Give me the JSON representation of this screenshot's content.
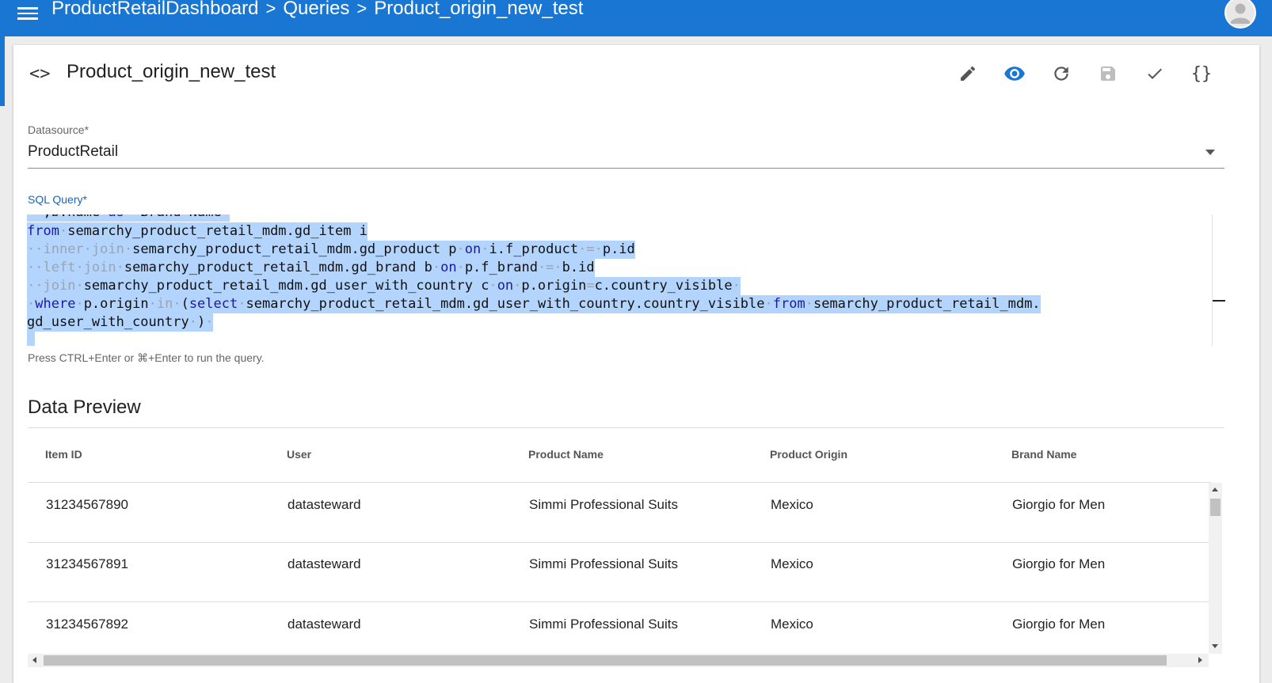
{
  "header": {
    "breadcrumb": [
      "ProductRetailDashboard",
      "Queries",
      "Product_origin_new_test"
    ]
  },
  "query": {
    "title": "Product_origin_new_test"
  },
  "toolbar": {
    "icons": [
      "pencil-icon",
      "eye-icon",
      "refresh-icon",
      "save-icon",
      "check-icon",
      "braces-icon"
    ],
    "active_color": "#1976d2",
    "braces_label": "{}"
  },
  "code_toggle_glyph": "<>",
  "datasource": {
    "label": "Datasource*",
    "value": "ProductRetail"
  },
  "sql": {
    "label": "SQL Query*",
    "lines": [
      [
        {
          "t": "  ,b.name ",
          "c": ""
        },
        {
          "t": "as",
          "c": "kw"
        },
        {
          "t": " \"Brand Name\"",
          "c": ""
        }
      ],
      [
        {
          "t": "from",
          "c": "kw"
        },
        {
          "t": "·",
          "c": "ws"
        },
        {
          "t": "semarchy_product_retail_mdm.gd_item i",
          "c": ""
        }
      ],
      [
        {
          "t": "··",
          "c": "ws"
        },
        {
          "t": "inner",
          "c": "ws"
        },
        {
          "t": "·",
          "c": "ws"
        },
        {
          "t": "join",
          "c": "ws"
        },
        {
          "t": "·",
          "c": "ws"
        },
        {
          "t": "semarchy_product_retail_mdm.gd_product p",
          "c": ""
        },
        {
          "t": "·",
          "c": "ws"
        },
        {
          "t": "on",
          "c": "kw"
        },
        {
          "t": "·",
          "c": "ws"
        },
        {
          "t": "i.f_product",
          "c": ""
        },
        {
          "t": "·=·",
          "c": "ws"
        },
        {
          "t": "p.id",
          "c": ""
        }
      ],
      [
        {
          "t": "··",
          "c": "ws"
        },
        {
          "t": "left",
          "c": "ws"
        },
        {
          "t": "·",
          "c": "ws"
        },
        {
          "t": "join",
          "c": "ws"
        },
        {
          "t": "·",
          "c": "ws"
        },
        {
          "t": "semarchy_product_retail_mdm.gd_brand b",
          "c": ""
        },
        {
          "t": "·",
          "c": "ws"
        },
        {
          "t": "on",
          "c": "kw"
        },
        {
          "t": "·",
          "c": "ws"
        },
        {
          "t": "p.f_brand",
          "c": ""
        },
        {
          "t": "·=·",
          "c": "ws"
        },
        {
          "t": "b.id",
          "c": ""
        }
      ],
      [
        {
          "t": "··",
          "c": "ws"
        },
        {
          "t": "join",
          "c": "ws"
        },
        {
          "t": "·",
          "c": "ws"
        },
        {
          "t": "semarchy_product_retail_mdm.gd_user_with_country c",
          "c": ""
        },
        {
          "t": "·",
          "c": "ws"
        },
        {
          "t": "on",
          "c": "kw"
        },
        {
          "t": "·",
          "c": "ws"
        },
        {
          "t": "p.origin",
          "c": ""
        },
        {
          "t": "=",
          "c": "ws"
        },
        {
          "t": "c.country_visible",
          "c": ""
        },
        {
          "t": "·",
          "c": "ws"
        }
      ],
      [
        {
          "t": "·",
          "c": "ws"
        },
        {
          "t": "where",
          "c": "kw"
        },
        {
          "t": "·",
          "c": "ws"
        },
        {
          "t": "p.origin",
          "c": ""
        },
        {
          "t": "·",
          "c": "ws"
        },
        {
          "t": "in",
          "c": "ws"
        },
        {
          "t": "·",
          "c": "ws"
        },
        {
          "t": "(",
          "c": ""
        },
        {
          "t": "select",
          "c": "kw"
        },
        {
          "t": "·",
          "c": "ws"
        },
        {
          "t": "semarchy_product_retail_mdm.gd_user_with_country.country_visible",
          "c": ""
        },
        {
          "t": "·",
          "c": "ws"
        },
        {
          "t": "from",
          "c": "kw"
        },
        {
          "t": "·",
          "c": "ws"
        },
        {
          "t": "semarchy_product_retail_mdm.",
          "c": ""
        }
      ],
      [
        {
          "t": "gd_user_with_country",
          "c": ""
        },
        {
          "t": "·",
          "c": "ws"
        },
        {
          "t": ")",
          "c": ""
        },
        {
          "t": "·",
          "c": "ws"
        }
      ],
      [
        {
          "t": " ",
          "c": ""
        }
      ]
    ]
  },
  "hint": "Press CTRL+Enter or ⌘+Enter to run the query.",
  "preview": {
    "title": "Data Preview",
    "columns": [
      "Item ID",
      "User",
      "Product Name",
      "Product Origin",
      "Brand Name"
    ],
    "rows": [
      [
        "31234567890",
        "datasteward",
        "Simmi Professional Suits",
        "Mexico",
        "Giorgio for Men"
      ],
      [
        "31234567891",
        "datasteward",
        "Simmi Professional Suits",
        "Mexico",
        "Giorgio for Men"
      ],
      [
        "31234567892",
        "datasteward",
        "Simmi Professional Suits",
        "Mexico",
        "Giorgio for Men"
      ]
    ]
  }
}
